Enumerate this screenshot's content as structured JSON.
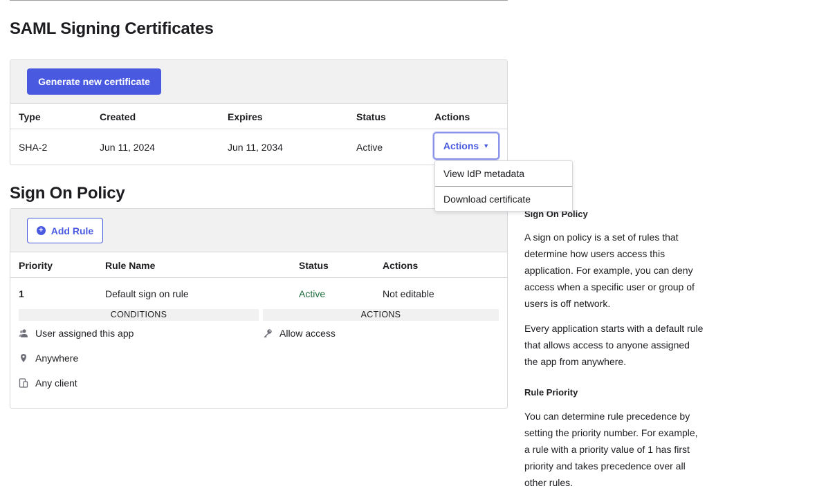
{
  "saml": {
    "title": "SAML Signing Certificates",
    "generate_button": "Generate new certificate",
    "columns": [
      "Type",
      "Created",
      "Expires",
      "Status",
      "Actions"
    ],
    "row": {
      "type": "SHA-2",
      "created": "Jun 11, 2024",
      "expires": "Jun 11, 2034",
      "status": "Active",
      "actions_button": "Actions"
    },
    "actions_menu": [
      "View IdP metadata",
      "Download certificate"
    ]
  },
  "sign_on_policy": {
    "title": "Sign On Policy",
    "add_rule_button": "Add Rule",
    "columns": [
      "Priority",
      "Rule Name",
      "Status",
      "Actions"
    ],
    "rule": {
      "priority": "1",
      "name": "Default sign on rule",
      "status": "Active",
      "actions": "Not editable"
    },
    "conditions_header": "CONDITIONS",
    "actions_header": "ACTIONS",
    "conditions": [
      "User assigned this app",
      "Anywhere",
      "Any client"
    ],
    "actions": [
      "Allow access"
    ]
  },
  "help": {
    "heading1": "Sign On Policy",
    "para1": "A sign on policy is a set of rules that determine how users access this application. For example, you can deny access when a specific user or group of users is off network.",
    "para2": "Every application starts with a default rule that allows access to anyone assigned the app from anywhere.",
    "heading2": "Rule Priority",
    "para3": "You can determine rule precedence by setting the priority number. For example, a rule with a priority value of 1 has first priority and takes precedence over all other rules."
  },
  "colors": {
    "primary": "#4a5ae0",
    "active_status": "#1e6b3d",
    "toolbar_bg": "#f1f1f1"
  }
}
